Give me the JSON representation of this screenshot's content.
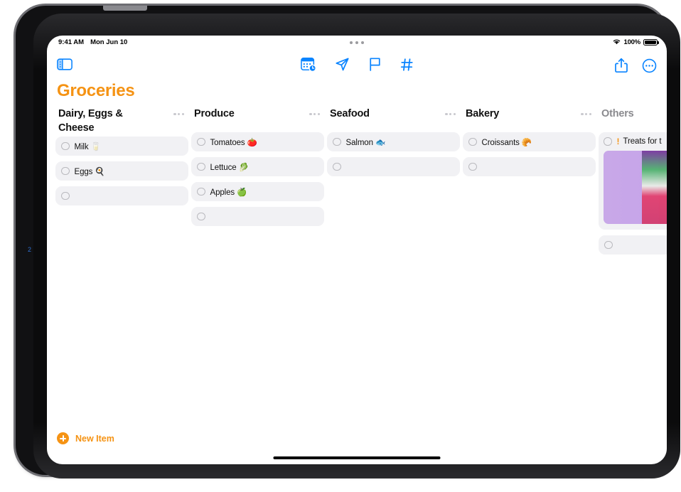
{
  "status_bar": {
    "time": "9:41 AM",
    "date": "Mon Jun 10",
    "wifi_icon": "wifi-icon",
    "battery_percent": "100%",
    "battery_icon": "battery-full-icon",
    "multitask_handle_icon": "multitasking-handle-icon"
  },
  "toolbar": {
    "sidebar_toggle_icon": "sidebar-toggle-icon",
    "center_items": [
      {
        "icon": "calendar-schedule-icon",
        "label": "Schedule"
      },
      {
        "icon": "location-send-icon",
        "label": "Location"
      },
      {
        "icon": "flag-icon",
        "label": "Flag"
      },
      {
        "icon": "tag-hash-icon",
        "label": "Tags"
      }
    ],
    "share_icon": "share-icon",
    "more_icon": "more-options-icon"
  },
  "board": {
    "title": "Groceries",
    "title_color": "#F59314",
    "menu_icon": "column-menu-ellipsis-icon",
    "columns": [
      {
        "name": "Dairy, Eggs & Cheese",
        "muted": false,
        "cards": [
          {
            "text": "Milk 🥛",
            "priority": "",
            "image": false
          },
          {
            "text": "Eggs 🍳",
            "priority": "",
            "image": false
          },
          {
            "text": "",
            "priority": "",
            "image": false
          }
        ]
      },
      {
        "name": "Produce",
        "muted": false,
        "cards": [
          {
            "text": "Tomatoes 🍅",
            "priority": "",
            "image": false
          },
          {
            "text": "Lettuce 🥬",
            "priority": "",
            "image": false
          },
          {
            "text": "Apples 🍏",
            "priority": "",
            "image": false
          },
          {
            "text": "",
            "priority": "",
            "image": false
          }
        ]
      },
      {
        "name": "Seafood",
        "muted": false,
        "cards": [
          {
            "text": "Salmon 🐟",
            "priority": "",
            "image": false
          },
          {
            "text": "",
            "priority": "",
            "image": false
          }
        ]
      },
      {
        "name": "Bakery",
        "muted": false,
        "cards": [
          {
            "text": "Croissants 🥐",
            "priority": "",
            "image": false
          },
          {
            "text": "",
            "priority": "",
            "image": false
          }
        ]
      },
      {
        "name": "Others",
        "muted": true,
        "cards": [
          {
            "text": "Treats for t",
            "priority": "!",
            "image": true
          },
          {
            "text": "",
            "priority": "",
            "image": false
          }
        ]
      }
    ]
  },
  "new_item": {
    "label": "New Item",
    "icon": "add-circle-icon",
    "color": "#F59314"
  },
  "home_indicator": "home-indicator",
  "annotation": {
    "mark": "2"
  }
}
